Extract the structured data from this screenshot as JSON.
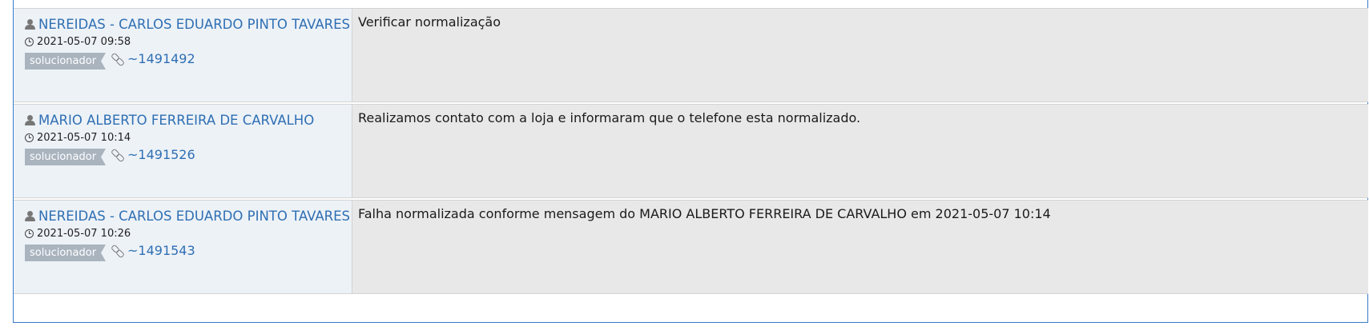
{
  "comments": [
    {
      "author": "NEREIDAS - CARLOS EDUARDO PINTO TAVARES",
      "timestamp": "2021-05-07 09:58",
      "role": "solucionador",
      "ref": "~1491492",
      "message": "Verificar normalização"
    },
    {
      "author": "MARIO ALBERTO FERREIRA DE CARVALHO",
      "timestamp": "2021-05-07 10:14",
      "role": "solucionador",
      "ref": "~1491526",
      "message": "Realizamos contato com a loja e informaram que o telefone esta normalizado."
    },
    {
      "author": "NEREIDAS - CARLOS EDUARDO PINTO TAVARES",
      "timestamp": "2021-05-07 10:26",
      "role": "solucionador",
      "ref": "~1491543",
      "message": "Falha normalizada conforme mensagem do MARIO ALBERTO FERREIRA DE CARVALHO em 2021-05-07 10:14"
    }
  ],
  "icons": {
    "author": "user-icon",
    "timestamp": "clock-icon",
    "ref": "link-icon"
  },
  "colors": {
    "link": "#2f6fb3",
    "meta_bg": "#edf2f7",
    "body_bg": "#e8e8e8",
    "badge_bg": "#aab4bf",
    "frame_border": "#3a7bc8"
  }
}
